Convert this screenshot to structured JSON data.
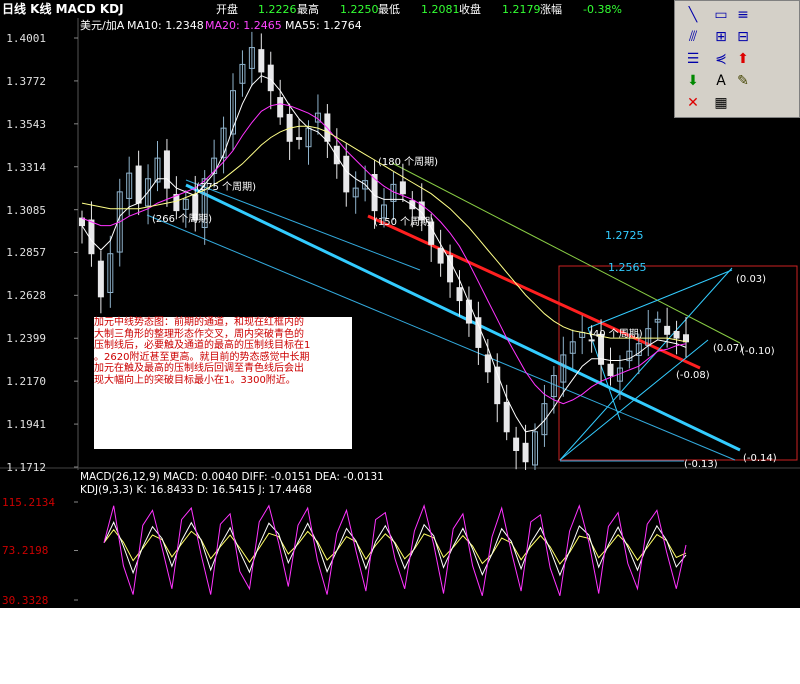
{
  "title_bar": {
    "title": "日线 K线 MACD KDJ",
    "open_label": "开盘",
    "open_value": "1.2226",
    "high_label": "最高",
    "high_value": "1.2250",
    "low_label": "最低",
    "low_value": "1.2081",
    "close_label": "收盘",
    "close_value": "1.2179",
    "change_label": "涨幅",
    "change_value": "-0.38%"
  },
  "legend": {
    "symbol": "美元/加A",
    "ma10": "MA10: 1.2348",
    "ma20": "MA20: 1.2465",
    "ma55": "MA55: 1.2764"
  },
  "colors": {
    "background": "#000000",
    "up_candle": "#8fb3cc",
    "down_candle": "#e8e8ea",
    "ma10": "#ffffff",
    "ma20": "#ff33ff",
    "ma55": "#ffff88",
    "red_channel": "#ff2020",
    "cyan_channel": "#33ccff",
    "frame_red": "#cc2222",
    "macd_axis": "#cc0000"
  },
  "chart_data": [
    {
      "type": "candlestick",
      "title": "美元/加A 日线",
      "ylim": [
        1.1712,
        1.4001
      ],
      "y_ticks": [
        "1.4001",
        "1.3772",
        "1.3543",
        "1.3314",
        "1.3085",
        "1.2857",
        "1.2628",
        "1.2399",
        "1.2170",
        "1.1941",
        "1.1712"
      ],
      "close_path": [
        1.3,
        1.285,
        1.262,
        1.285,
        1.318,
        1.328,
        1.312,
        1.325,
        1.336,
        1.32,
        1.308,
        1.314,
        1.303,
        1.325,
        1.336,
        1.352,
        1.372,
        1.386,
        1.395,
        1.382,
        1.372,
        1.358,
        1.345,
        1.346,
        1.352,
        1.36,
        1.345,
        1.333,
        1.318,
        1.32,
        1.324,
        1.308,
        1.311,
        1.322,
        1.317,
        1.309,
        1.303,
        1.29,
        1.28,
        1.27,
        1.26,
        1.248,
        1.235,
        1.222,
        1.205,
        1.19,
        1.18,
        1.174,
        1.19,
        1.205,
        1.22,
        1.231,
        1.238,
        1.243,
        1.239,
        1.226,
        1.22,
        1.224,
        1.233,
        1.237,
        1.245,
        1.25,
        1.242,
        1.24,
        1.238
      ],
      "moving_averages": {
        "MA10": [
          1.3,
          1.292,
          1.287,
          1.292,
          1.305,
          1.31,
          1.312,
          1.318,
          1.325,
          1.325,
          1.32,
          1.318,
          1.316,
          1.322,
          1.328,
          1.338,
          1.352,
          1.365,
          1.375,
          1.38,
          1.378,
          1.372,
          1.364,
          1.357,
          1.352,
          1.35,
          1.345,
          1.337,
          1.329,
          1.325,
          1.322,
          1.316,
          1.314,
          1.314,
          1.314,
          1.311,
          1.307,
          1.299,
          1.29,
          1.281,
          1.271,
          1.259,
          1.247,
          1.235,
          1.221,
          1.208,
          1.198,
          1.19,
          1.191,
          1.196,
          1.203,
          1.211,
          1.218,
          1.225,
          1.229,
          1.229,
          1.228,
          1.228,
          1.229,
          1.232,
          1.236,
          1.239,
          1.238,
          1.237,
          1.235
        ],
        "MA20": [
          1.304,
          1.302,
          1.3,
          1.3,
          1.302,
          1.305,
          1.307,
          1.309,
          1.312,
          1.314,
          1.316,
          1.318,
          1.32,
          1.324,
          1.329,
          1.334,
          1.34,
          1.348,
          1.355,
          1.361,
          1.364,
          1.365,
          1.364,
          1.362,
          1.36,
          1.357,
          1.352,
          1.346,
          1.34,
          1.335,
          1.33,
          1.325,
          1.321,
          1.318,
          1.316,
          1.314,
          1.311,
          1.307,
          1.302,
          1.296,
          1.289,
          1.28,
          1.27,
          1.26,
          1.25,
          1.24,
          1.231,
          1.222,
          1.215,
          1.21,
          1.207,
          1.205,
          1.207,
          1.21,
          1.214,
          1.217,
          1.219,
          1.221,
          1.223,
          1.225,
          1.229,
          1.233,
          1.234,
          1.236,
          1.237
        ],
        "MA55": [
          1.312,
          1.311,
          1.31,
          1.309,
          1.309,
          1.309,
          1.309,
          1.31,
          1.311,
          1.312,
          1.313,
          1.315,
          1.317,
          1.319,
          1.322,
          1.325,
          1.329,
          1.333,
          1.338,
          1.343,
          1.347,
          1.35,
          1.352,
          1.353,
          1.353,
          1.352,
          1.35,
          1.347,
          1.344,
          1.341,
          1.338,
          1.335,
          1.332,
          1.329,
          1.326,
          1.323,
          1.32,
          1.317,
          1.313,
          1.309,
          1.304,
          1.299,
          1.293,
          1.287,
          1.281,
          1.275,
          1.269,
          1.263,
          1.258,
          1.253,
          1.249,
          1.246,
          1.244,
          1.243,
          1.242,
          1.241,
          1.24,
          1.24,
          1.24,
          1.24,
          1.24,
          1.24,
          1.24,
          1.239,
          1.238
        ]
      },
      "price_labels": [
        "1.2725",
        "1.2565"
      ],
      "annotations": [
        "(275 个周期)",
        "(266 个周期)",
        "(180 个周期)",
        "(150 个周期)",
        "(40 个周期)",
        "(0.03)",
        "(0.07)",
        "(-0.10)",
        "(-0.08)",
        "(-0.13)",
        "(-0.14)"
      ]
    },
    {
      "type": "line",
      "title": "MACD(26,12,9)",
      "values": {
        "MACD": 0.004,
        "DIFF": -0.0151,
        "DEA": -0.0131
      }
    },
    {
      "type": "line",
      "title": "KDJ(9,3,3)",
      "ylim": [
        30.3328,
        115.2134
      ],
      "y_ticks": [
        "115.2134",
        "73.2198",
        "30.3328"
      ],
      "values": {
        "K": 16.8433,
        "D": 16.5415,
        "J": 17.4468
      },
      "J_path": [
        80,
        112,
        60,
        35,
        95,
        108,
        75,
        40,
        100,
        110,
        70,
        35,
        96,
        105,
        55,
        40,
        98,
        112,
        80,
        42,
        95,
        110,
        65,
        35,
        88,
        108,
        72,
        38,
        100,
        106,
        66,
        40,
        90,
        112,
        78,
        36,
        92,
        105,
        60,
        34,
        85,
        110,
        72,
        38,
        98,
        104,
        58,
        34,
        90,
        112,
        80,
        36,
        94,
        106,
        62,
        40,
        96,
        108,
        72,
        40,
        78
      ]
    }
  ],
  "indicator_header": {
    "macd": "MACD(26,12,9) MACD: 0.0040  DIFF: -0.0151  DEA: -0.0131",
    "kdj": "KDJ(9,3,3) K: 16.8433  D: 16.5415  J: 17.4468"
  },
  "note": {
    "text": "加元中线势态图：前期的通道，和现在红框内的\n大制三角形的整理形态作交叉，周内突破青色的\n压制线后，必要触及通道的最高的压制线目标在1\n。2620附近甚至更高。就目前的势态感觉中长期\n加元在触及最高的压制线后回调至青色线后会出\n现大幅向上的突破目标最小在1。3300附近。"
  },
  "toolbar": {
    "buttons": [
      {
        "name": "line-tool-icon",
        "glyph": "╲"
      },
      {
        "name": "parallel-channel-icon",
        "glyph": "▭"
      },
      {
        "name": "equal-lines-icon",
        "glyph": "≡"
      },
      {
        "name": "fibonacci-icon",
        "glyph": "⫻"
      },
      {
        "name": "grid-tool-icon",
        "glyph": "⊞"
      },
      {
        "name": "gann-icon",
        "glyph": "⊟"
      },
      {
        "name": "list-icon",
        "glyph": "☰"
      },
      {
        "name": "fan-icon",
        "glyph": "⋞"
      },
      {
        "name": "up-arrow-icon",
        "glyph": "⬆"
      },
      {
        "name": "down-arrow-icon",
        "glyph": "⬇"
      },
      {
        "name": "text-tool-icon",
        "glyph": "A"
      },
      {
        "name": "eraser-icon",
        "glyph": "✎"
      },
      {
        "name": "delete-icon",
        "glyph": "✕"
      },
      {
        "name": "properties-icon",
        "glyph": "▦"
      }
    ]
  }
}
